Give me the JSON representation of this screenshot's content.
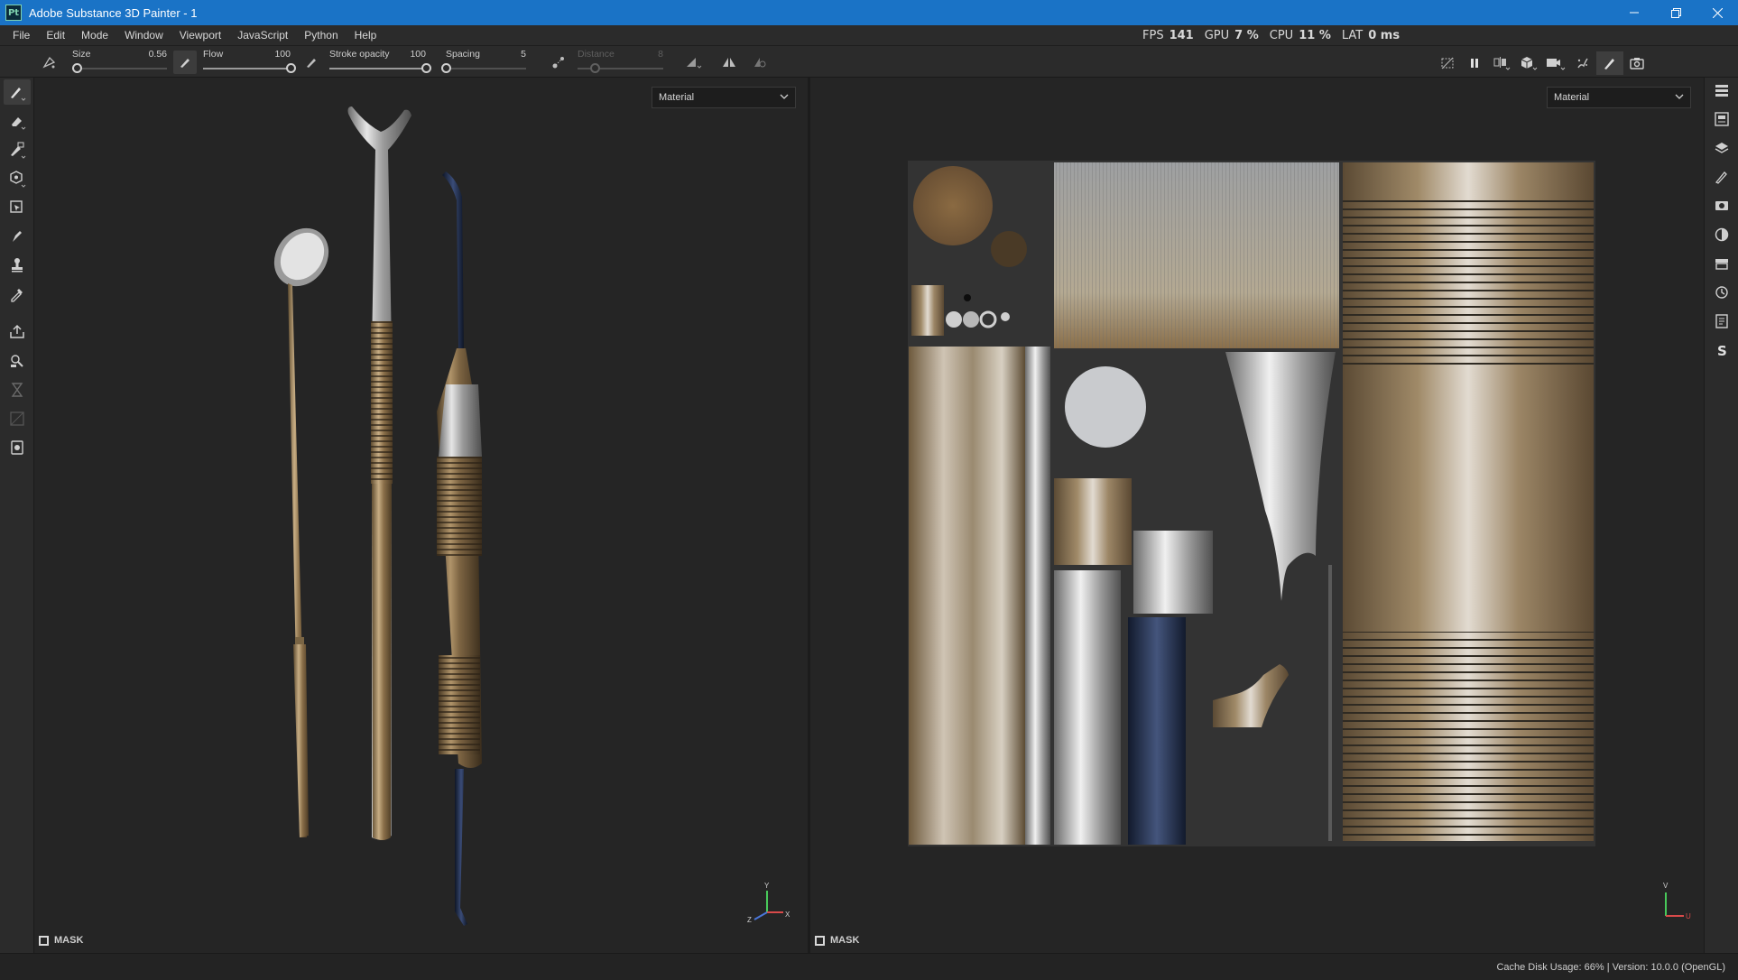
{
  "window": {
    "title": "Adobe Substance 3D Painter - 1",
    "logo_text": "Pt",
    "controls": [
      "minimize-icon",
      "restore-icon",
      "close-icon"
    ]
  },
  "menu": {
    "items": [
      "File",
      "Edit",
      "Mode",
      "Window",
      "Viewport",
      "JavaScript",
      "Python",
      "Help"
    ]
  },
  "stats": {
    "fps_label": "FPS",
    "fps_value": "141",
    "gpu_label": "GPU",
    "gpu_value": "7 %",
    "cpu_label": "CPU",
    "cpu_value": "11 %",
    "lat_label": "LAT",
    "lat_value": "0 ms"
  },
  "toolbar": {
    "size": {
      "label": "Size",
      "value": "0.56",
      "level": 0.05
    },
    "flow": {
      "label": "Flow",
      "value": "100",
      "level": 1.0
    },
    "stroke_opacity": {
      "label": "Stroke opacity",
      "value": "100",
      "level": 1.0
    },
    "spacing": {
      "label": "Spacing",
      "value": "5",
      "level": 0.0
    },
    "distance": {
      "label": "Distance",
      "value": "8",
      "level": 0.2,
      "enabled": false
    },
    "right_tools": [
      "hide-icon",
      "pause-icon",
      "symmetry-icon",
      "cube-icon",
      "camera-icon",
      "splatter-icon",
      "brush-icon",
      "screenshot-icon"
    ]
  },
  "left_tools": [
    "paint-brush-icon",
    "eraser-icon",
    "projection-icon",
    "geometry-fill-icon",
    "polygon-fill-icon",
    "smudge-icon",
    "clone-stamp-icon",
    "color-picker-icon",
    "bake-export-icon",
    "iray-icon",
    "hourglass-icon",
    "uv-tool-icon",
    "viewer-icon"
  ],
  "right_dock": [
    "layers-list-icon",
    "texture-set-icon",
    "layers-icon",
    "brush-settings-icon",
    "display-settings-icon",
    "shader-icon",
    "assets-icon",
    "history-icon",
    "log-icon",
    "substance-icon"
  ],
  "viewport_3d": {
    "dropdown_value": "Material",
    "mask_label": "MASK",
    "axis_labels": {
      "x": "X",
      "y": "Y",
      "z": "Z"
    }
  },
  "viewport_2d": {
    "dropdown_value": "Material",
    "mask_label": "MASK",
    "axis_labels": {
      "u": "U",
      "v": "V"
    }
  },
  "status": {
    "text": "Cache Disk Usage:    66% | Version: 10.0.0 (OpenGL)"
  },
  "colors": {
    "titlebar": "#1a73c6",
    "panel": "#2b2b2b",
    "viewport": "#252525",
    "metal_gold": "#9a7d55",
    "metal_silver": "#c9c9c9",
    "navy": "#1e2a44"
  }
}
